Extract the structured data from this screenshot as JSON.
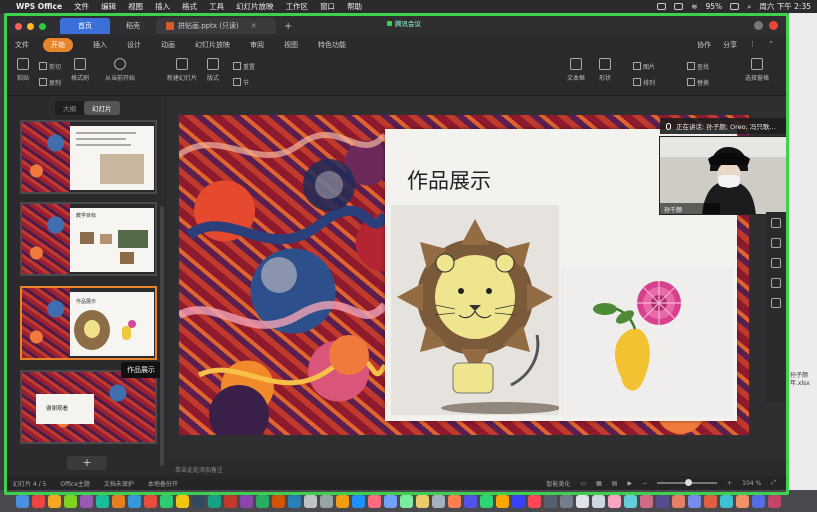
{
  "menubar": {
    "app": "WPS Office",
    "items": [
      "文件",
      "编辑",
      "视图",
      "插入",
      "格式",
      "工具",
      "幻灯片放映",
      "工作区",
      "窗口",
      "帮助"
    ],
    "battery": "95%",
    "clock": "周六 下午 2:35"
  },
  "window": {
    "home_tab": "首页",
    "second_tab": "稻壳",
    "doc_tab": "拼贴画.pptx (只读)",
    "meeting_chip": "腾讯会议"
  },
  "ribbon_tabs": {
    "file": "文件",
    "tabs": [
      "开始",
      "插入",
      "设计",
      "动画",
      "幻灯片放映",
      "审阅",
      "视图",
      "特色功能"
    ],
    "active": "开始",
    "right": [
      "协作",
      "分享"
    ]
  },
  "ribbon_tools": {
    "paste": "粘贴",
    "cut": "剪切",
    "copy": "复制",
    "format_painter": "格式刷",
    "play": "从当前开始",
    "new_slide": "新建幻灯片",
    "layout": "版式",
    "reset": "重置",
    "section": "节",
    "textbox": "文本框",
    "shape": "形状",
    "arrange": "排列",
    "picture": "图片",
    "find": "查找",
    "replace": "替换",
    "select": "选择窗格"
  },
  "left_panel": {
    "outline_tab": "大纲",
    "slides_tab": "幻灯片",
    "thumbs": [
      "1",
      "2",
      "3",
      "4"
    ],
    "thumb2_title": "教学目标",
    "thumb3_title": "作品展示",
    "thumb4_title": "谢谢观看",
    "tooltip": "作品展示"
  },
  "slide": {
    "title": "作品展示"
  },
  "notes": {
    "placeholder": "单击此处添加备注"
  },
  "statusbar": {
    "slide_count": "幻灯片 4 / 5",
    "theme": "Office主题",
    "doc_protect": "文档未保护",
    "local_backup": "本地备份开",
    "smart_beautify": "智能美化",
    "zoom": "104 %"
  },
  "meeting": {
    "speaker": "正在讲话: 孙子颜; Oreo; 冯只歌…",
    "video_name": "孙千颜"
  },
  "background_window": {
    "lines": [
      "孙子颜",
      "年.xlsx"
    ]
  },
  "colors": {
    "accent_orange": "#e8852a",
    "share_green": "#3ed04f",
    "home_tab_blue": "#3c6fd8"
  }
}
